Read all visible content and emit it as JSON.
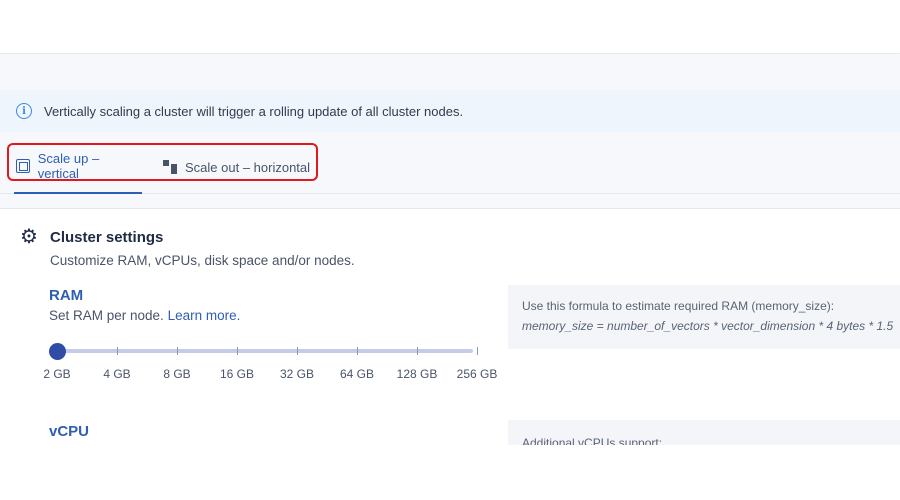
{
  "banner": {
    "text": "Vertically scaling a cluster will trigger a rolling update of all cluster nodes.",
    "icon": "info-icon"
  },
  "tabs": [
    {
      "label": "Scale up – vertical",
      "icon": "chip-icon",
      "active": true
    },
    {
      "label": "Scale out – horizontal",
      "icon": "nodes-icon",
      "active": false
    }
  ],
  "settings": {
    "title": "Cluster settings",
    "subtitle": "Customize RAM, vCPUs, disk space and/or nodes.",
    "icon": "gear-icon"
  },
  "ram": {
    "title": "RAM",
    "subtitle": "Set RAM per node.",
    "learn_more": "Learn more.",
    "options": [
      "2 GB",
      "4 GB",
      "8 GB",
      "16 GB",
      "32 GB",
      "64 GB",
      "128 GB",
      "256 GB"
    ],
    "selected": "2 GB",
    "hint_line1": "Use this formula to estimate required RAM (memory_size):",
    "hint_line2": "memory_size = number_of_vectors * vector_dimension * 4 bytes * 1.5"
  },
  "vcpu": {
    "title": "vCPU",
    "hint": "Additional vCPUs support:"
  },
  "colors": {
    "accent": "#2f5eb5",
    "highlight": "#e0191f",
    "banner_bg": "#eef5fc"
  }
}
